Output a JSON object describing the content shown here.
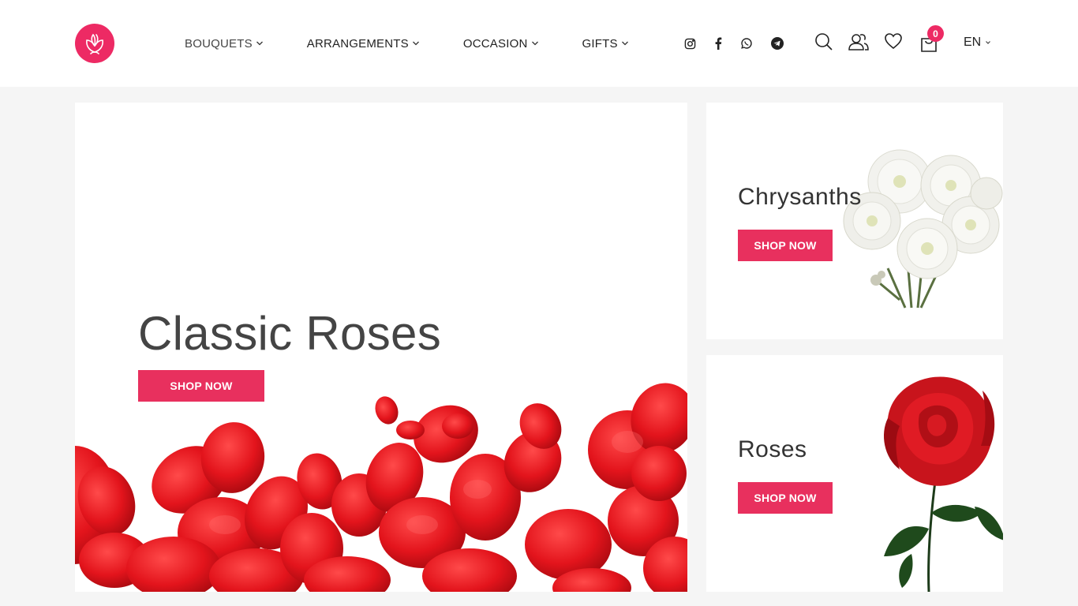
{
  "header": {
    "nav": [
      {
        "label": "BOUQUETS"
      },
      {
        "label": "ARRANGEMENTS"
      },
      {
        "label": "OCCASION"
      },
      {
        "label": "GIFTS"
      }
    ],
    "cart_count": "0",
    "language": "EN"
  },
  "icons": {
    "logo": "flower-logo-icon",
    "social": [
      "instagram-icon",
      "facebook-icon",
      "whatsapp-icon",
      "telegram-icon"
    ],
    "tools": [
      "search-icon",
      "account-icon",
      "heart-icon",
      "cart-icon"
    ]
  },
  "hero": {
    "title": "Classic Roses",
    "button": "SHOP NOW"
  },
  "promo_1": {
    "title": "Chrysanths",
    "button": "SHOP NOW"
  },
  "promo_2": {
    "title": "Roses",
    "button": "SHOP NOW"
  },
  "colors": {
    "accent": "#e8305e",
    "logo": "#ed2a64",
    "background": "#f5f5f5",
    "petal": "#e01b24"
  }
}
